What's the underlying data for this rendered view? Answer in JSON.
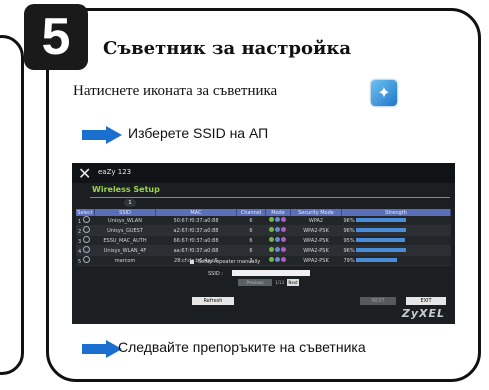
{
  "step_number": "5",
  "title": "Съветник за настройка",
  "instructions": {
    "step1": "Натиснете иконата за съветника",
    "step2": "Изберете SSID на АП",
    "step3": "Следвайте препоръките на съветника"
  },
  "icons": {
    "wizard": "magic-wand-icon",
    "arrow": "arrow-right-icon"
  },
  "colors": {
    "arrow": "#1a6fcf",
    "accent_green": "#9bd44d",
    "table_header": "#5a6fb8",
    "strength_bar": "#4a8cd8"
  },
  "screenshot": {
    "brand": "eaZy 123",
    "heading": "Wireless Setup",
    "page_badge": "1",
    "columns": [
      "Select",
      "SSID",
      "MAC",
      "Channel",
      "Mode",
      "Security Mode",
      "Strength"
    ],
    "rows": [
      {
        "n": "1",
        "ssid": "Unisys_WLAN",
        "mac": "50:67:f0:37:a0:88",
        "channel": "6",
        "security": "WPA2",
        "strength": "96%",
        "level": 0.96
      },
      {
        "n": "2",
        "ssid": "Unisys_GUEST",
        "mac": "a2:67:f0:37:a0:88",
        "channel": "6",
        "security": "WPA2-PSK",
        "strength": "96%",
        "level": 0.96
      },
      {
        "n": "3",
        "ssid": "ESSU_MAC_AUTH",
        "mac": "66:67:f0:37:a0:88",
        "channel": "6",
        "security": "WPA2-PSK",
        "strength": "95%",
        "level": 0.95
      },
      {
        "n": "4",
        "ssid": "Unisys_WLAN_4F",
        "mac": "aa:67:f0:37:a0:88",
        "channel": "6",
        "security": "WPA2-PSK",
        "strength": "96%",
        "level": 0.96
      },
      {
        "n": "5",
        "ssid": "marcom",
        "mac": "28:cf:da:b6:4a:c5",
        "channel": "3",
        "security": "WPA2-PSK",
        "strength": "79%",
        "level": 0.79
      }
    ],
    "manual_label": "Setup repeater manually",
    "ssid_label": "SSID :",
    "previous": "Previous",
    "page_of": "1/13",
    "next_small": "Next",
    "refresh": "Refresh",
    "next": "NEXT",
    "exit": "EXIT",
    "logo": "ZyXEL"
  }
}
